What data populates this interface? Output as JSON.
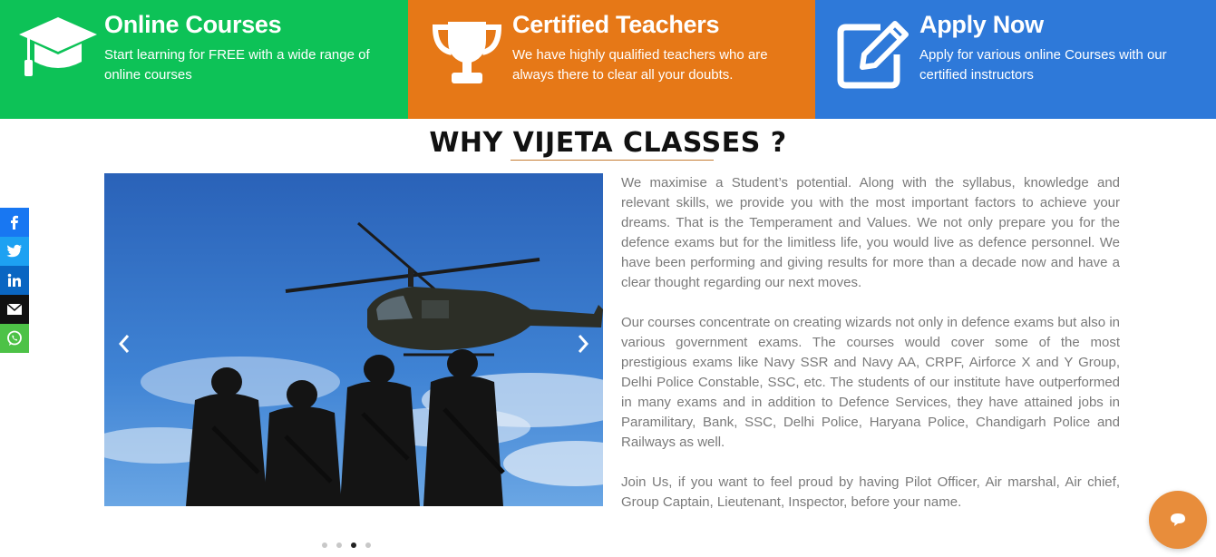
{
  "features": [
    {
      "title": "Online Courses",
      "text": "Start learning for FREE with a wide range of online courses",
      "icon": "graduation-cap-icon",
      "color": "#0dc257"
    },
    {
      "title": "Certified Teachers",
      "text": "We have highly qualified teachers who are always there to clear all your doubts.",
      "icon": "trophy-icon",
      "color": "#e67817"
    },
    {
      "title": "Apply Now",
      "text": "Apply for various online Courses with our certified instructors",
      "icon": "edit-icon",
      "color": "#2e79d9"
    }
  ],
  "section": {
    "title": "WHY VIJETA CLASSES ?",
    "paragraphs": [
      "We maximise a Student’s potential. Along with the syllabus, knowledge and relevant skills, we provide you with the most important factors to achieve your dreams. That is the Temperament and Values. We not only prepare you for the defence exams but for the limitless life, you would live as defence personnel. We have been performing and giving results for more than a decade now and have a clear thought regarding our next moves.",
      "Our courses concentrate on creating wizards not only in defence exams but also in various government exams. The courses would cover some of the most prestigious exams like Navy SSR and Navy AA, CRPF, Airforce X and Y Group, Delhi Police Constable, SSC, etc. The students of our institute have outperformed in many exams and in addition to Defence Services, they have attained jobs in Paramilitary, Bank, SSC, Delhi Police, Haryana Police, Chandigarh Police and Railways as well.",
      "Join Us, if you want to feel proud by having Pilot Officer, Air marshal, Air chief, Group Captain, Lieutenant, Inspector, before your name."
    ]
  },
  "social": [
    "facebook-icon",
    "twitter-icon",
    "linkedin-icon",
    "email-icon",
    "whatsapp-icon"
  ],
  "carousel": {
    "slides": 4,
    "active": 3
  }
}
